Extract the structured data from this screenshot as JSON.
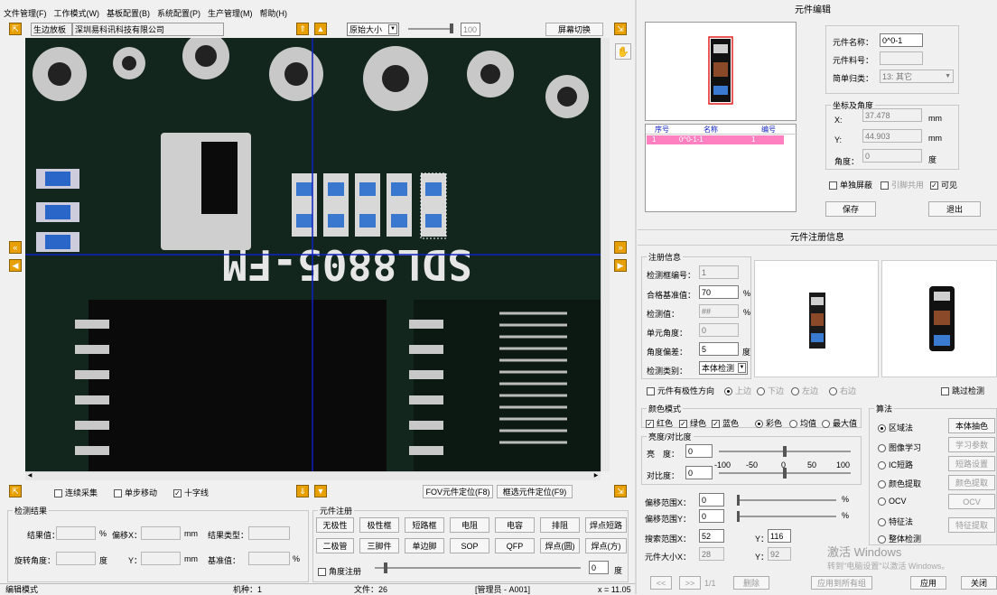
{
  "menu": [
    "文件管理(F)",
    "工作模式(W)",
    "基板配置(B)",
    "系统配置(P)",
    "生产管理(M)",
    "帮助(H)"
  ],
  "toolbar": {
    "board_tab": "生边放板",
    "company": "深圳易科讯科技有限公司",
    "zoom_select": "原始大小",
    "zoom_value": "100",
    "screen_switch": "屏幕切换"
  },
  "pcb_text": "SDL8805-FM",
  "bottom_opts": {
    "continuous": "连续采集",
    "step_move": "单步移动",
    "crosshair": "十字线",
    "fov_locate": "FOV元件定位(F8)",
    "frame_locate": "框选元件定位(F9)"
  },
  "detect_result": {
    "title": "检测结果",
    "result_value": "结果值：",
    "pct": "%",
    "offset_x": "偏移X：",
    "mm1": "mm",
    "result_type": "结果类型：",
    "rotate_angle": "旋转角度：",
    "deg": "度",
    "y": "Y：",
    "mm2": "mm",
    "base_value": "基准值：",
    "pct2": "%"
  },
  "comp_register": {
    "title": "元件注册",
    "buttons": [
      "无极性",
      "极性框",
      "短路框",
      "电阻",
      "电容",
      "排阻",
      "焊点短路",
      "二极管",
      "三脚件",
      "单边脚",
      "SOP",
      "QFP",
      "焊点(圆)",
      "焊点(方)"
    ],
    "angle_reg": "角度注册",
    "angle_value": "0",
    "deg": "度"
  },
  "status": {
    "mode": "编辑模式",
    "machine": "机种：1",
    "file": "文件：26",
    "user": "[管理员 - A001]",
    "coord": "x = 11.05"
  },
  "edit_panel": {
    "title": "元件编辑",
    "name_label": "元件名称：",
    "name_value": "0^0-1",
    "part_label": "元件料号：",
    "part_value": "",
    "class_label": "简单归类：",
    "class_value": "13: 其它",
    "coord_title": "坐标及角度",
    "x_label": "X:",
    "x_value": "37.478",
    "y_label": "Y:",
    "y_value": "44.903",
    "angle_label": "角度：",
    "angle_value": "0",
    "mm": "mm",
    "deg": "度",
    "single_mask": "单独屏蔽",
    "ref_share": "引脚共用",
    "visible": "可见",
    "save": "保存",
    "exit": "退出"
  },
  "comp_list": {
    "headers": [
      "序号",
      "名称",
      "编号"
    ],
    "rows": [
      [
        "1",
        "0^0-1-1",
        "1"
      ]
    ]
  },
  "reg_info": {
    "title": "元件注册信息",
    "group": "注册信息",
    "box_id_label": "检测框编号：",
    "box_id": "1",
    "pass_label": "合格基准值：",
    "pass_value": "70",
    "pct": "%",
    "detect_label": "检测值：",
    "detect_value": "##",
    "unit_angle_label": "单元角度：",
    "unit_angle": "0",
    "angle_dev_label": "角度偏差：",
    "angle_dev": "5",
    "deg": "度",
    "detect_type_label": "检测类别：",
    "detect_type": "本体检测",
    "polarity": "元件有极性方向",
    "up": "上边",
    "down": "下边",
    "left": "左边",
    "right": "右边",
    "skip": "跳过检测"
  },
  "color_mode": {
    "title": "颜色模式",
    "red": "红色",
    "green": "绿色",
    "blue": "蓝色",
    "color": "彩色",
    "mean": "均值",
    "max": "最大值"
  },
  "brightness": {
    "title": "亮度/对比度",
    "bright_label": "亮　度：",
    "bright_value": "0",
    "contrast_label": "对比度：",
    "contrast_value": "0",
    "ticks": [
      "-100",
      "-50",
      "0",
      "50",
      "100"
    ]
  },
  "offsets": {
    "x_label": "偏移范围X：",
    "x_value": "0",
    "y_label": "偏移范围Y：",
    "y_value": "0",
    "pct": "%",
    "search_x_label": "搜索范围X：",
    "search_x": "52",
    "search_y_label": "Y：",
    "search_y": "116",
    "size_x_label": "元件大小X：",
    "size_x": "28",
    "size_y_label": "Y：",
    "size_y": "92"
  },
  "algorithm": {
    "title": "算法",
    "options": [
      "区域法",
      "图像学习",
      "IC短路",
      "颜色提取",
      "OCV",
      "特征法",
      "整体检测"
    ],
    "buttons": [
      "本体抽色",
      "学习参数",
      "短路设置",
      "颜色提取",
      "OCV",
      "特征提取"
    ]
  },
  "nav": {
    "prev": "<<",
    "next": ">>",
    "page": "1/1",
    "delete": "删除",
    "apply_all": "应用到所有组",
    "apply": "应用",
    "close": "关闭"
  },
  "watermark": {
    "line1": "激活 Windows",
    "line2": "转到\"电脑设置\"以激活 Windows。"
  }
}
